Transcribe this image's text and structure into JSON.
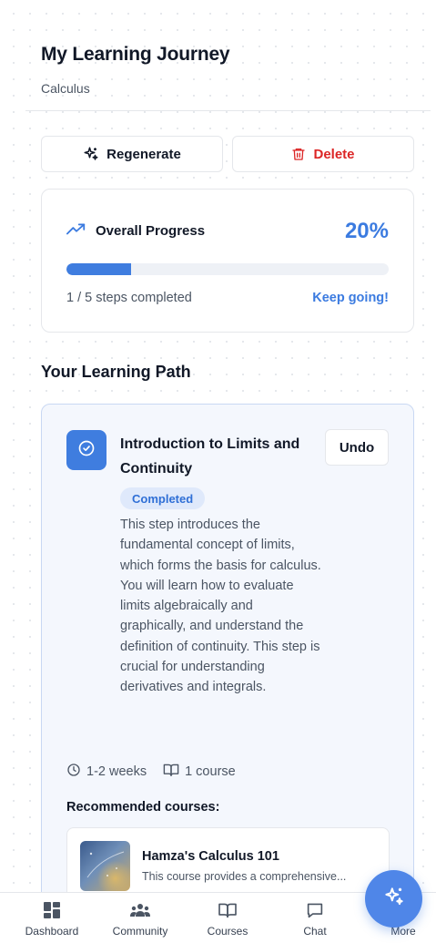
{
  "header": {
    "title": "My Learning Journey",
    "subtitle": "Calculus"
  },
  "actions": {
    "regenerate_label": "Regenerate",
    "delete_label": "Delete"
  },
  "progress": {
    "heading": "Overall Progress",
    "percent_label": "20%",
    "fraction": 0.2,
    "steps_text": "1 / 5 steps completed",
    "encouragement": "Keep going!"
  },
  "learning_path": {
    "heading": "Your Learning Path",
    "steps": [
      {
        "title": "Introduction to Limits and Continuity",
        "status": "Completed",
        "undo_label": "Undo",
        "description": "This step introduces the fundamental concept of limits, which forms the basis for calculus. You will learn how to evaluate limits algebraically and graphically, and understand the definition of continuity. This step is crucial for understanding derivatives and integrals.",
        "duration": "1-2 weeks",
        "courses_count": "1 course",
        "recommended_label": "Recommended courses:",
        "courses": [
          {
            "title": "Hamza's Calculus 101",
            "description": "This course provides a comprehensive..."
          }
        ]
      }
    ]
  },
  "nav": {
    "items": [
      {
        "label": "Dashboard",
        "icon": "dashboard-icon"
      },
      {
        "label": "Community",
        "icon": "community-icon"
      },
      {
        "label": "Courses",
        "icon": "book-open-icon"
      },
      {
        "label": "Chat",
        "icon": "chat-icon"
      },
      {
        "label": "More",
        "icon": "more-icon"
      }
    ]
  },
  "colors": {
    "accent": "#3b7be0",
    "danger": "#dc2626",
    "badge_bg": "#dfe9fb",
    "card_highlight_bg": "#f4f7fd"
  }
}
